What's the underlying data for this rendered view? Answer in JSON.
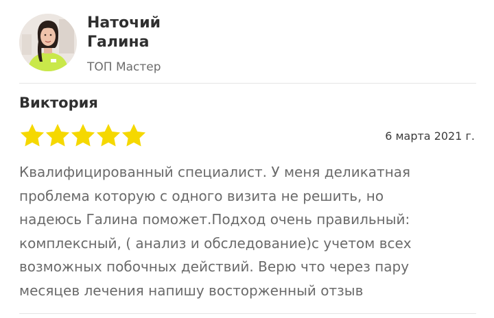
{
  "master": {
    "name_line1": "Наточий",
    "name_line2": "Галина",
    "rank": "ТОП Мастер"
  },
  "review": {
    "author": "Виктория",
    "rating": 5,
    "max_rating": 5,
    "star_color": "#f5d800",
    "date": "6 марта 2021 г.",
    "text_lines": [
      "Квалифицированный специалист. У меня деликатная",
      "проблема которую с одного визита не решить, но",
      "надеюсь Галина поможет.Подход очень правильный:",
      "комплексный, ( анализ и обследование)с учетом всех",
      "возможных побочных действий. Верю что через пару",
      "месяцев лечения напишу восторженный отзыв"
    ]
  }
}
